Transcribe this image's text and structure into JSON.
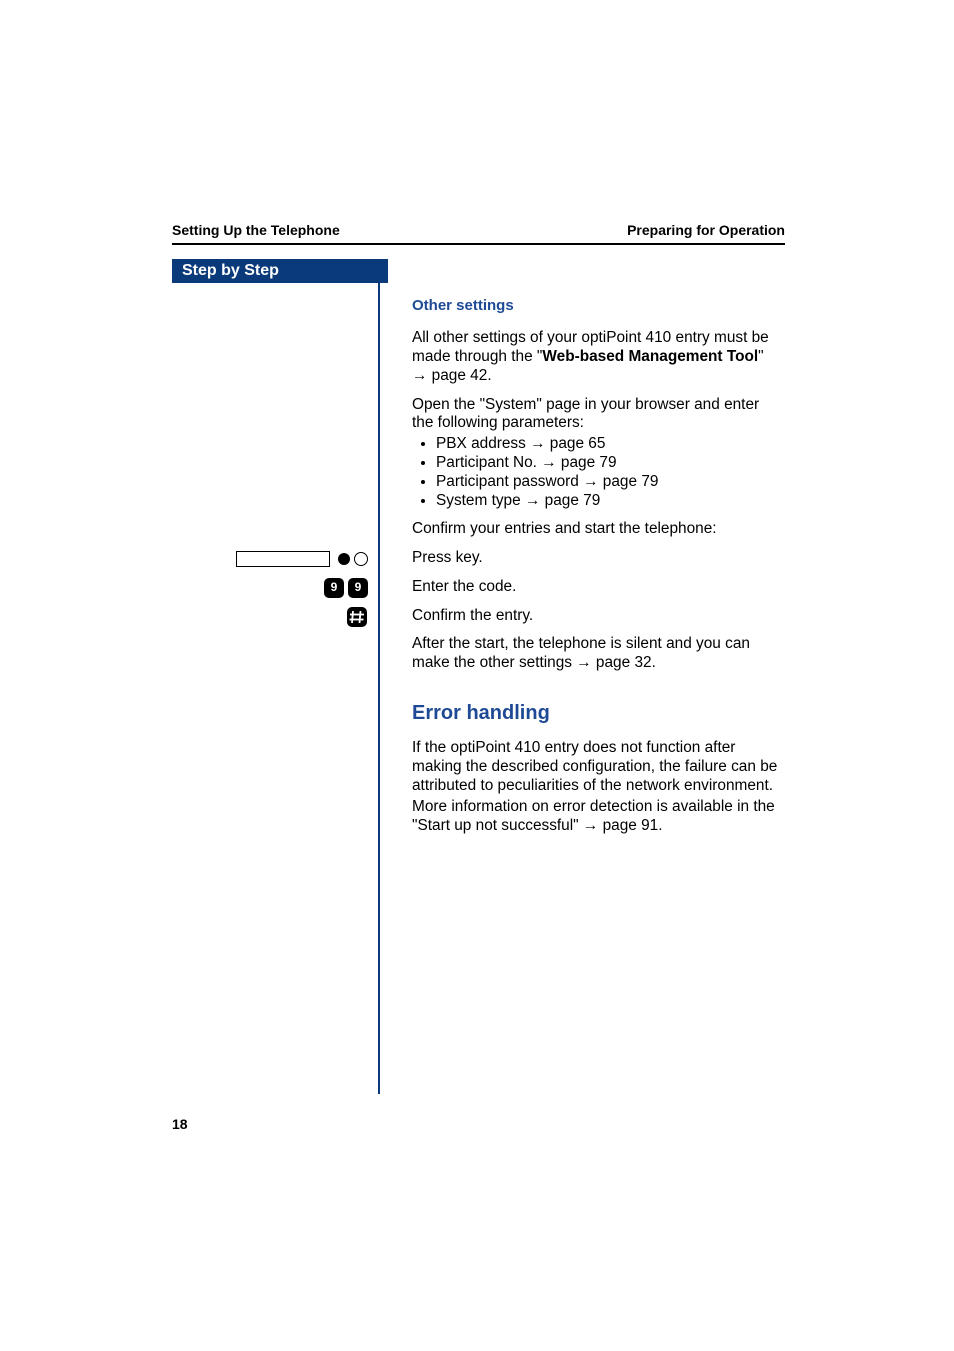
{
  "header": {
    "left": "Setting Up the Telephone",
    "right": "Preparing for Operation"
  },
  "stepbar": "Step by Step",
  "h_other": "Other settings",
  "p1_a": "All other settings of your optiPoint 410 entry must be made through the \"",
  "p1_b_bold": "Web-based Management Tool",
  "p1_c": "\" ",
  "p1_link": "→ page 42",
  "p1_d": ".",
  "p2": "Open the \"System\" page in your browser and enter the following parameters:",
  "bullets": [
    {
      "pre": "PBX address ",
      "lnk": "→ page 65"
    },
    {
      "pre": "Participant No. ",
      "lnk": "→ page 79"
    },
    {
      "pre": "Participant password ",
      "lnk": "→ page 79"
    },
    {
      "pre": "System type ",
      "lnk": "→ page 79"
    }
  ],
  "p3": "Confirm your entries and start the telephone:",
  "step_press": "Press key.",
  "step_code": "Enter the code.",
  "step_confirm": "Confirm the entry.",
  "p4_a": "After the start, the telephone is silent and you can make the other settings ",
  "p4_link": "→ page 32",
  "p4_b": ".",
  "h_err": "Error handling",
  "err_a": "If the optiPoint 410 entry does not function after making the described configuration, the failure can be attributed to peculiarities of the network environment.",
  "err_b_a": "More information on error detection is available in the \"Start up not successful\" ",
  "err_b_link": "→ page 91",
  "err_b_b": ".",
  "keydigit": "9",
  "pagenum": "18"
}
